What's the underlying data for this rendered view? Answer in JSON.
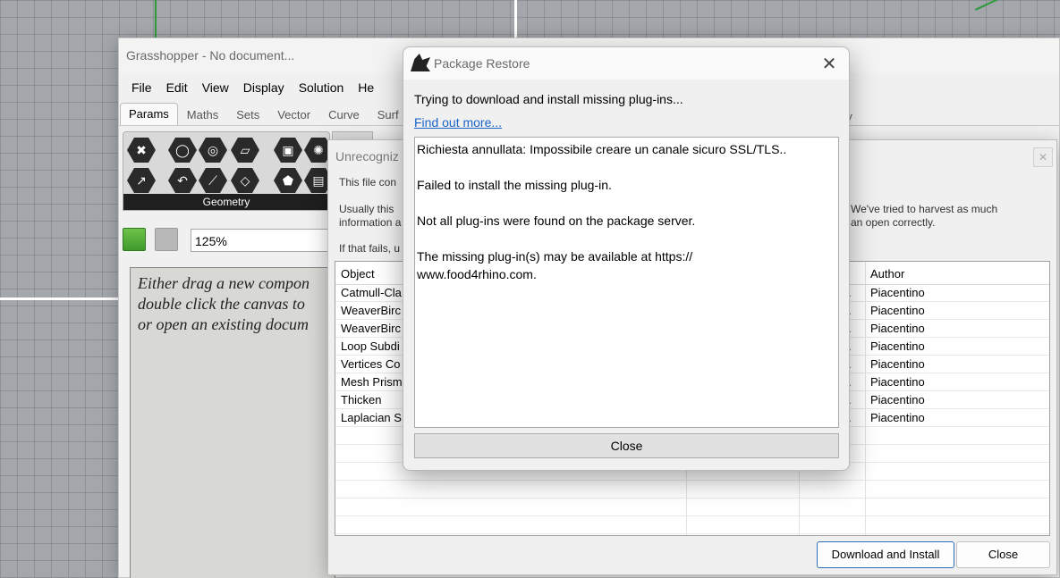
{
  "gh": {
    "title": "Grasshopper - No document...",
    "menu": [
      "File",
      "Edit",
      "View",
      "Display",
      "Solution",
      "He"
    ],
    "tabs": [
      "Params",
      "Maths",
      "Sets",
      "Vector",
      "Curve",
      "Surf"
    ],
    "tab_right": "ay",
    "palette_group": "Geometry",
    "zoom": "125%",
    "canvas_hint": "Either drag a new compon\ndouble click the canvas to\nor open an existing docum"
  },
  "unrec": {
    "title": "Unrecogniz",
    "text1": "This file con",
    "text2": "Usually this\ninformation a",
    "text2r": "We've tried to harvest as much\nan open correctly.",
    "text3": "If that fails, u",
    "col_object": "Object",
    "col_author": "Author",
    "rows": [
      {
        "object": "Catmull-Cla",
        "mid": "...",
        "author": "Piacentino"
      },
      {
        "object": "WeaverBirc",
        "mid": "...",
        "author": "Piacentino"
      },
      {
        "object": "WeaverBirc",
        "mid": "...",
        "author": "Piacentino"
      },
      {
        "object": "Loop Subdi",
        "mid": "...",
        "author": "Piacentino"
      },
      {
        "object": "Vertices Co",
        "mid": "...",
        "author": "Piacentino"
      },
      {
        "object": "Mesh Prism",
        "mid": "...",
        "author": "Piacentino"
      },
      {
        "object": "Thicken",
        "mid": "...",
        "author": "Piacentino"
      },
      {
        "object": "Laplacian S",
        "mid": "...",
        "author": "Piacentino"
      }
    ],
    "download_button": "Download and Install",
    "close_button": "Close"
  },
  "pkg": {
    "title": "Package Restore",
    "message": "Trying to download and install missing plug-ins...",
    "link": "Find out more...",
    "log": [
      "Richiesta annullata: Impossibile creare un canale sicuro SSL/TLS..",
      "Failed to install the missing plug-in.",
      "Not all plug-ins were found on the package server.",
      "The missing plug-in(s) may be available at https://\nwww.food4rhino.com."
    ],
    "close_button": "Close"
  }
}
